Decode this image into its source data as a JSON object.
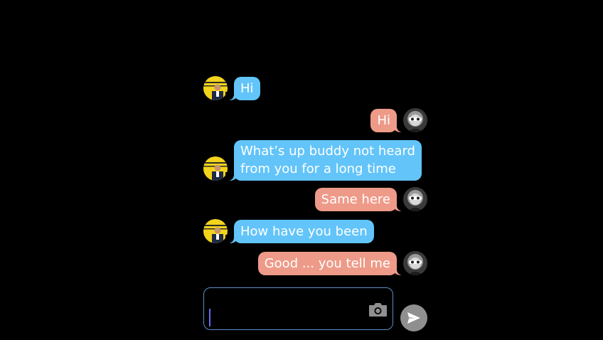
{
  "colors": {
    "background": "#000000",
    "incoming_bubble": "#62c4f9",
    "outgoing_bubble": "#ee9a88",
    "input_border": "#5a8fc2",
    "send_button": "#8f8f8f",
    "caret": "#6a6bf0"
  },
  "messages": [
    {
      "direction": "incoming",
      "text": "Hi",
      "avatar": "friend-avatar"
    },
    {
      "direction": "outgoing",
      "text": "Hi",
      "avatar": "user-avatar"
    },
    {
      "direction": "incoming",
      "lines": [
        "What’s up buddy not heard",
        "from you for a long time"
      ],
      "avatar": "friend-avatar"
    },
    {
      "direction": "outgoing",
      "text": "Same here",
      "avatar": "user-avatar"
    },
    {
      "direction": "incoming",
      "text": "How have you been",
      "avatar": "friend-avatar"
    },
    {
      "direction": "outgoing",
      "text": "Good ... you tell me",
      "avatar": "user-avatar"
    }
  ],
  "composer": {
    "value": "",
    "placeholder": "",
    "camera_icon": "camera-icon",
    "send_icon": "send-icon"
  }
}
